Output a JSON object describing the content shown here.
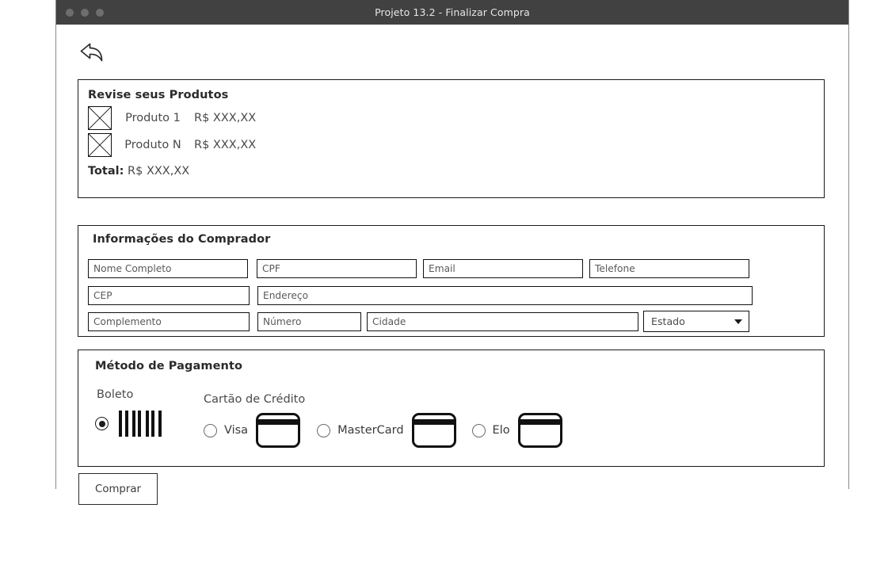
{
  "window": {
    "title": "Projeto 13.2 - Finalizar Compra",
    "traffic_dots": [
      "dot-1",
      "dot-2",
      "dot-3"
    ],
    "titlebar_color": "#414141",
    "dot_color": "#6e6e6e"
  },
  "nav": {
    "back_icon": "back-arrow-icon"
  },
  "products": {
    "title": "Revise seus Produtos",
    "items": [
      {
        "thumb": "image-placeholder-icon",
        "name": "Produto 1",
        "price": "R$ XXX,XX"
      },
      {
        "thumb": "image-placeholder-icon",
        "name": "Produto N",
        "price": "R$ XXX,XX"
      }
    ],
    "total_label": "Total:",
    "total_value": "R$ XXX,XX"
  },
  "buyer": {
    "title": "Informações do Comprador",
    "fields": {
      "nome": {
        "placeholder": "Nome Completo",
        "value": ""
      },
      "cpf": {
        "placeholder": "CPF",
        "value": ""
      },
      "email": {
        "placeholder": "Email",
        "value": ""
      },
      "telefone": {
        "placeholder": "Telefone",
        "value": ""
      },
      "cep": {
        "placeholder": "CEP",
        "value": ""
      },
      "endereco": {
        "placeholder": "Endereço",
        "value": ""
      },
      "complemento": {
        "placeholder": "Complemento",
        "value": ""
      },
      "numero": {
        "placeholder": "Número",
        "value": ""
      },
      "cidade": {
        "placeholder": "Cidade",
        "value": ""
      }
    },
    "estado_select": {
      "selected": "Estado",
      "icon": "chevron-down-icon"
    }
  },
  "payment": {
    "title": "Método de Pagamento",
    "boleto": {
      "label": "Boleto",
      "selected": true,
      "icon": "barcode-icon"
    },
    "credit_card": {
      "label": "Cartão de Crédito",
      "options": [
        {
          "label": "Visa",
          "selected": false,
          "icon": "credit-card-icon"
        },
        {
          "label": "MasterCard",
          "selected": false,
          "icon": "credit-card-icon"
        },
        {
          "label": "Elo",
          "selected": false,
          "icon": "credit-card-icon"
        }
      ]
    }
  },
  "actions": {
    "buy_label": "Comprar"
  }
}
